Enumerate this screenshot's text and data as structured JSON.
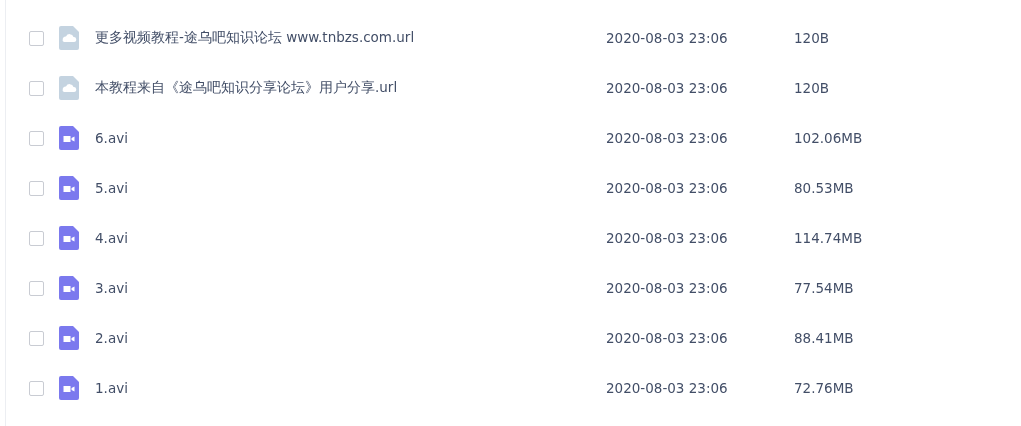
{
  "files": [
    {
      "kind": "link",
      "name": "更多视频教程-途乌吧知识论坛 www.tnbzs.com.url",
      "date": "2020-08-03 23:06",
      "size": "120B",
      "checked": false
    },
    {
      "kind": "link",
      "name": "本教程来自《途乌吧知识分享论坛》用户分享.url",
      "date": "2020-08-03 23:06",
      "size": "120B",
      "checked": false
    },
    {
      "kind": "video",
      "name": "6.avi",
      "date": "2020-08-03 23:06",
      "size": "102.06MB",
      "checked": false
    },
    {
      "kind": "video",
      "name": "5.avi",
      "date": "2020-08-03 23:06",
      "size": "80.53MB",
      "checked": false
    },
    {
      "kind": "video",
      "name": "4.avi",
      "date": "2020-08-03 23:06",
      "size": "114.74MB",
      "checked": false
    },
    {
      "kind": "video",
      "name": "3.avi",
      "date": "2020-08-03 23:06",
      "size": "77.54MB",
      "checked": false
    },
    {
      "kind": "video",
      "name": "2.avi",
      "date": "2020-08-03 23:06",
      "size": "88.41MB",
      "checked": false
    },
    {
      "kind": "video",
      "name": "1.avi",
      "date": "2020-08-03 23:06",
      "size": "72.76MB",
      "checked": false
    }
  ]
}
